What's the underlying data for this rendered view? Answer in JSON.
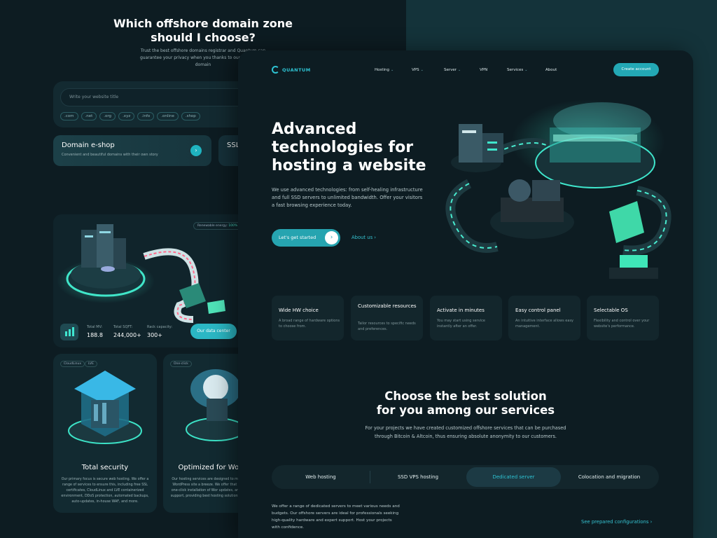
{
  "background_page": {
    "title_line1": "Which offshore domain zone",
    "title_line2": "should I choose?",
    "subtitle": "Trust the best offshore domains registrar and Quantum can guarantee your privacy when you thanks to our anonymous domain",
    "search_placeholder": "Write your website title",
    "zones": [
      ".com",
      ".net",
      ".org",
      ".xyz",
      ".info",
      ".online",
      ".shop"
    ],
    "eshop": {
      "title": "Domain e-shop",
      "subtitle": "Convenient and beautiful domains with their own story"
    },
    "ssl": {
      "title": "SSL"
    },
    "datacenter": {
      "renewable_label": "Renewable energy:",
      "renewable_value": "100%",
      "stats": [
        {
          "label": "Total MV:",
          "value": "188.8"
        },
        {
          "label": "Total SQFT:",
          "value": "244,000+"
        },
        {
          "label": "Rack capacity:",
          "value": "300+"
        }
      ],
      "button": "Our data center"
    },
    "security_card": {
      "tags": [
        "CloudLinux",
        "LVE"
      ],
      "title": "Total security",
      "text": "Our primary focus is secure web hosting. We offer a range of services to ensure this, including free SSL certificates, CloudLinux and LVE containerized environment, DDoS protection, automated backups, auto-updates, in-house WAF, and more."
    },
    "wordpress_card": {
      "tags": [
        "One-click"
      ],
      "title": "Optimized for Word",
      "text": "Our hosting services are designed to make your WordPress site a breeze. We offer that includes one-click installation of Wor updates, and expert support, providing best hosting solutions availabl"
    }
  },
  "main": {
    "logo": "QUANTUM",
    "nav": [
      {
        "label": "Hosting",
        "dropdown": true
      },
      {
        "label": "VPS",
        "dropdown": true
      },
      {
        "label": "Server",
        "dropdown": true
      },
      {
        "label": "VPN",
        "dropdown": false
      },
      {
        "label": "Services",
        "dropdown": true
      },
      {
        "label": "About",
        "dropdown": false
      }
    ],
    "create_account": "Create account",
    "hero": {
      "title": "Advanced technologies for hosting a website",
      "text": "We use advanced technologies: from self-healing infrastructure and full SSD servers to unlimited bandwidth. Offer your visitors a fast browsing experience today.",
      "primary_button": "Let's get started",
      "secondary_link": "About us"
    },
    "features": [
      {
        "title": "Wide HW choice",
        "text": "A broad range of hardware options to choose from."
      },
      {
        "title": "Customizable resources",
        "text": "Tailor resources to specific needs and preferences."
      },
      {
        "title": "Activate in minutes",
        "text": "You may start using service instantly after an offer."
      },
      {
        "title": "Easy control panel",
        "text": "An intuitive interface allows easy management."
      },
      {
        "title": "Selectable OS",
        "text": "Flexibility and control over your website's performance."
      }
    ],
    "solutions": {
      "title_line1": "Choose the best solution",
      "title_line2": "for you among our services",
      "subtitle": "For your projects we have created customized offshore services that can be purchased through Bitcoin & Altcoin, thus ensuring absolute anonymity to our customers.",
      "tabs": [
        "Web hosting",
        "SSD VPS hosting",
        "Dedicated server",
        "Colocation and migration"
      ],
      "active_tab": "Dedicated server",
      "description": "We offer a range of dedicated servers to meet various needs and budgets. Our offshore servers are ideal for professionals seeking high-quality hardware and expert support. Host your projects with confidence.",
      "see_link": "See prepared configurations"
    }
  },
  "colors": {
    "accent": "#2ec3d3",
    "button": "#26a4b0",
    "panel": "#0d1c22",
    "backdrop": "#14333a"
  }
}
